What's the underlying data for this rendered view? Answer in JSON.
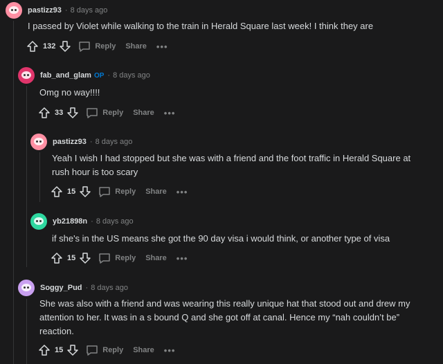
{
  "comments": [
    {
      "username": "pastizz93",
      "op_badge": "",
      "separator": "·",
      "time": "8 days ago",
      "body": "I passed by Violet while walking to the train in Herald Square last week! I think they are",
      "votes": "132",
      "reply_label": "Reply",
      "share_label": "Share",
      "more_label": "•••",
      "avatar_color": "#ff8fa3"
    },
    {
      "username": "fab_and_glam",
      "op_badge": "OP",
      "separator": "·",
      "time": "8 days ago",
      "body": "Omg no way!!!!",
      "votes": "33",
      "reply_label": "Reply",
      "share_label": "Share",
      "more_label": "•••",
      "avatar_color": "#e0356b"
    },
    {
      "username": "pastizz93",
      "op_badge": "",
      "separator": "·",
      "time": "8 days ago",
      "body": "Yeah I wish I had stopped but she was with a friend and the foot traffic in Herald Square at rush hour is too scary",
      "votes": "15",
      "reply_label": "Reply",
      "share_label": "Share",
      "more_label": "•••",
      "avatar_color": "#ff8fa3"
    },
    {
      "username": "yb21898n",
      "op_badge": "",
      "separator": "·",
      "time": "8 days ago",
      "body": "if she's in the US means she got the 90 day visa i would think, or another type of visa",
      "votes": "15",
      "reply_label": "Reply",
      "share_label": "Share",
      "more_label": "•••",
      "avatar_color": "#2ed8a0"
    },
    {
      "username": "Soggy_Pud",
      "op_badge": "",
      "separator": "·",
      "time": "8 days ago",
      "body": "She was also with a friend and was wearing this really unique hat that stood out and drew my attention to her. It was in a s bound Q and she got off at canal. Hence my “nah couldn’t be” reaction.",
      "votes": "15",
      "reply_label": "Reply",
      "share_label": "Share",
      "more_label": "•••",
      "avatar_color": "#c9a0f0"
    }
  ]
}
